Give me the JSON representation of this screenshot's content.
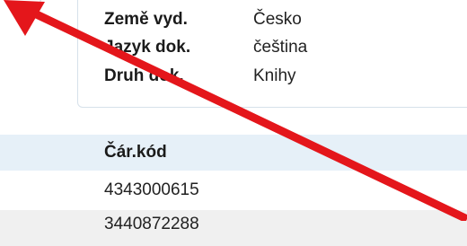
{
  "details": {
    "rows": [
      {
        "label": "Země vyd.",
        "value": "Česko"
      },
      {
        "label": "Jazyk dok.",
        "value": "čeština"
      },
      {
        "label": "Druh dok.",
        "value": "Knihy"
      }
    ]
  },
  "table": {
    "header": "Čár.kód",
    "rows": [
      "4343000615",
      "3440872288"
    ]
  },
  "colors": {
    "annotation_arrow": "#e4161b",
    "table_header_bg": "#e6f0f8",
    "panel_border": "#d6e1ea"
  }
}
